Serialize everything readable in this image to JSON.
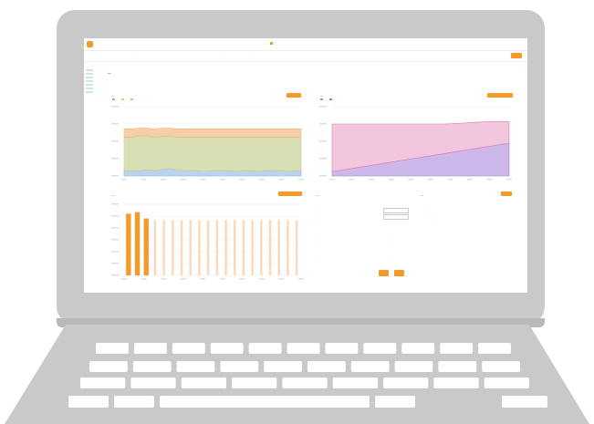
{
  "colors": {
    "accent": "#f39a2a",
    "laptop_frame": "#c9c9c9",
    "keys": "#ffffff",
    "chart1_band_green": "#d9dfb5",
    "chart1_band_orange": "#f6cfa8",
    "chart1_band_blue": "#bcd3f0",
    "chart2_pink": "#f2c6dc",
    "chart2_purple": "#cdb8ec",
    "bar_orange": "#f39a2a",
    "bar_light": "#fbd8b7"
  },
  "topbar": {
    "logo_icon": "orange-square-logo",
    "logo_text": "...",
    "nav_items": [
      "...",
      "..."
    ],
    "banner_text": "...",
    "user_text": "..."
  },
  "steps": [
    "...",
    "...",
    "...",
    "...",
    "..."
  ],
  "breadcrumb": "...",
  "breadcrumb_right": "...",
  "page_title": "...",
  "cards": {
    "area_chart": {
      "title": "...",
      "legend": [
        "...",
        "...",
        "..."
      ]
    },
    "stacked_chart": {
      "title": "...",
      "legend": [
        "...",
        "..."
      ]
    },
    "bar_chart": {
      "title": "..."
    },
    "financial": {
      "title": "...",
      "rows": [
        {
          "label": "...",
          "value": "..."
        },
        {
          "label": "...",
          "value": "..."
        },
        {
          "label": "...",
          "value": "..."
        },
        {
          "label": "...",
          "value": "..."
        },
        {
          "label": "...",
          "value": "..."
        },
        {
          "label": "...",
          "value": "..."
        }
      ]
    },
    "notes": {
      "title": "...",
      "items": [
        "...",
        "...",
        "...",
        "..."
      ]
    }
  },
  "chart_data": [
    {
      "type": "area",
      "title": "",
      "x": [
        1,
        2,
        3,
        4,
        5,
        6,
        7,
        8,
        9,
        10,
        11,
        12,
        13,
        14,
        15,
        16,
        17,
        18,
        19,
        20,
        21,
        22,
        23,
        24
      ],
      "series": [
        {
          "values": [
            8,
            7,
            8,
            9,
            8,
            10,
            11,
            9,
            8,
            8,
            7,
            7,
            8,
            8,
            7,
            7,
            8,
            7,
            7,
            8,
            8,
            7,
            7,
            8
          ]
        },
        {
          "values": [
            48,
            49,
            50,
            49,
            48,
            47,
            46,
            47,
            48,
            48,
            49,
            49,
            48,
            48,
            49,
            49,
            48,
            49,
            49,
            48,
            48,
            49,
            49,
            48
          ]
        },
        {
          "values": [
            12,
            12,
            11,
            11,
            12,
            12,
            12,
            12,
            12,
            12,
            12,
            12,
            12,
            12,
            12,
            12,
            12,
            12,
            12,
            12,
            12,
            12,
            12,
            12
          ]
        }
      ]
    },
    {
      "type": "area",
      "title": "",
      "x": [
        1,
        2,
        3,
        4,
        5,
        6,
        7,
        8,
        9,
        10,
        11,
        12
      ],
      "series": [
        {
          "values": [
            5,
            8,
            11,
            14,
            17,
            20,
            23,
            26,
            29,
            32,
            35,
            38
          ]
        },
        {
          "values": [
            55,
            52,
            49,
            46,
            43,
            40,
            37,
            34,
            32,
            30,
            28,
            25
          ]
        }
      ]
    },
    {
      "type": "bar",
      "title": "",
      "categories": [
        "1",
        "2",
        "3",
        "4",
        "5",
        "6",
        "7",
        "8",
        "9",
        "10",
        "11",
        "12",
        "13",
        "14",
        "15",
        "16",
        "17",
        "18",
        "19",
        "20"
      ],
      "values": [
        78,
        80,
        72,
        70,
        70,
        70,
        70,
        70,
        70,
        70,
        70,
        70,
        70,
        70,
        70,
        70,
        70,
        70,
        70,
        70
      ],
      "highlighted": [
        true,
        true,
        true,
        false,
        false,
        false,
        false,
        false,
        false,
        false,
        false,
        false,
        false,
        false,
        false,
        false,
        false,
        false,
        false,
        false
      ]
    }
  ],
  "keyboard": {
    "rows": [
      11,
      10,
      9,
      5
    ]
  }
}
